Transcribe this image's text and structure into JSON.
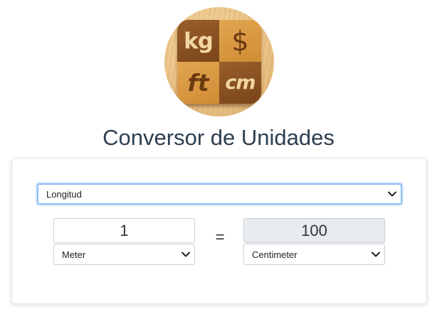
{
  "app": {
    "title": "Conversor de Unidades"
  },
  "logo": {
    "tiles": [
      "kg",
      "$",
      "ft",
      "cm"
    ]
  },
  "converter": {
    "category": "Longitud",
    "from_value": "1",
    "from_unit": "Meter",
    "equals": "=",
    "to_value": "100",
    "to_unit": "Centimeter"
  },
  "colors": {
    "title": "#2d3e50",
    "focus_border": "#8ebdf3",
    "readonly_bg": "#e9ecef",
    "logo_dark_tile": "#8a5224",
    "logo_light_tile": "#d8983f"
  },
  "icons": {
    "select_arrow": "chevron-down-icon"
  }
}
